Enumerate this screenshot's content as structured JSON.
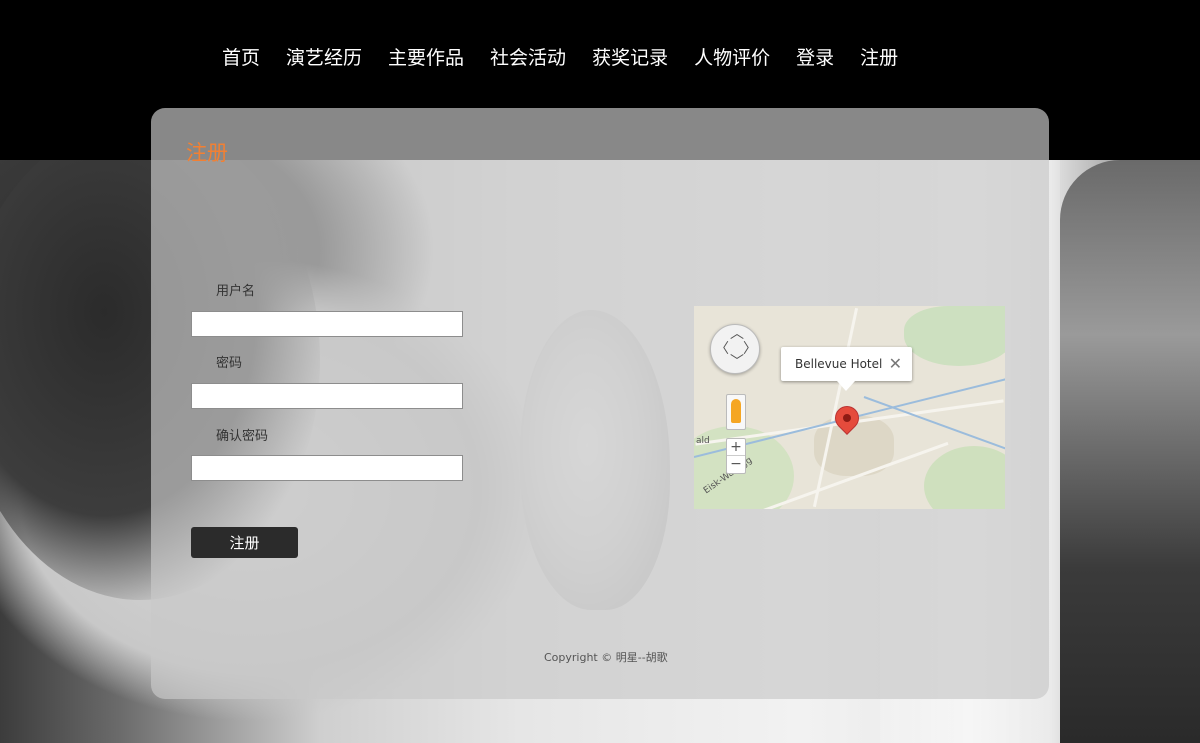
{
  "nav": {
    "items": [
      {
        "label": "首页"
      },
      {
        "label": "演艺经历"
      },
      {
        "label": "主要作品"
      },
      {
        "label": "社会活动"
      },
      {
        "label": "获奖记录"
      },
      {
        "label": "人物评价"
      },
      {
        "label": "登录"
      },
      {
        "label": "注册"
      }
    ]
  },
  "form": {
    "title": "注册",
    "username_label": "用户名",
    "username_value": "",
    "password_label": "密码",
    "password_value": "",
    "confirm_label": "确认密码",
    "confirm_value": "",
    "submit_label": "注册"
  },
  "map": {
    "info_title": "Bellevue Hotel",
    "close_glyph": "✕",
    "zoom_in": "+",
    "zoom_out": "−",
    "road_label_1": "Eisk-Wallegg",
    "road_label_2": "ald",
    "accent_marker": "#e54b3c"
  },
  "footer": {
    "copyright": "Copyright © 明星--胡歌"
  },
  "colors": {
    "title_accent": "#f28033",
    "button_bg": "#2b2b2b"
  }
}
